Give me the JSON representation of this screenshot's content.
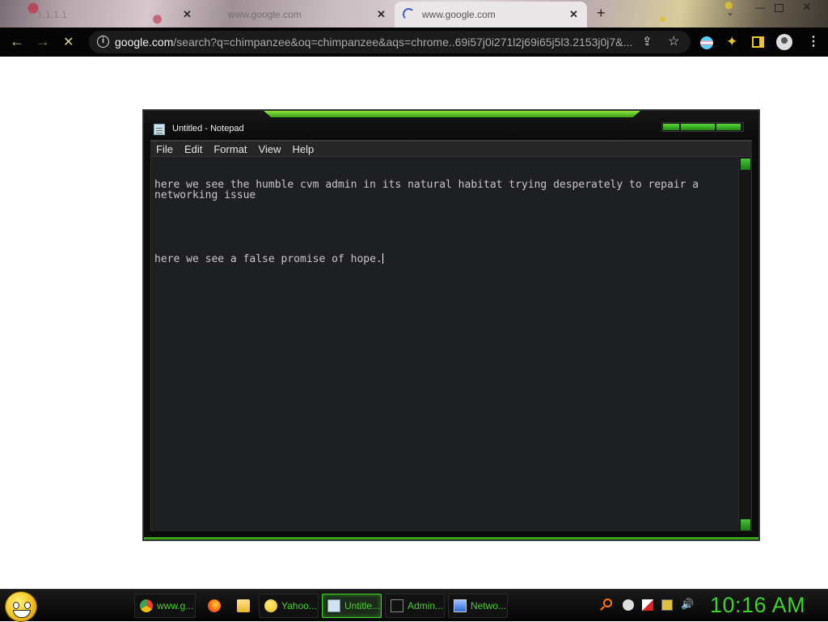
{
  "browser": {
    "tabs": [
      {
        "label": "1.1.1.1",
        "active": false
      },
      {
        "label": "www.google.com",
        "active": false
      },
      {
        "label": "www.google.com",
        "active": true
      }
    ],
    "new_tab_icon": "plus-icon",
    "url_host": "google.com",
    "url_rest": "/search?q=chimpanzee&oq=chimpanzee&aqs=chrome..69i57j0i271l2j69i65j5l3.2153j0j7&..."
  },
  "notepad": {
    "title": "Untitled - Notepad",
    "menu": [
      "File",
      "Edit",
      "Format",
      "View",
      "Help"
    ],
    "text_line1": "here we see the humble cvm admin in its natural habitat trying desperately to repair a networking issue",
    "text_line2": "here we see a false promise of hope."
  },
  "taskbar": {
    "tasks": [
      {
        "label": "www.g...",
        "icon": "chrome-icon"
      },
      {
        "label": "",
        "icon": "firefox-icon"
      },
      {
        "label": "",
        "icon": "folder-icon"
      },
      {
        "label": "Yahoo...",
        "icon": "yahoo-messenger-icon"
      },
      {
        "label": "Untitle...",
        "icon": "notepad-icon",
        "active": true
      },
      {
        "label": "Admin...",
        "icon": "cmd-icon"
      },
      {
        "label": "Netwo...",
        "icon": "network-icon"
      }
    ],
    "clock": "10:16 AM"
  },
  "colors": {
    "accent_green": "#46d42f",
    "browser_toolbar": "#050505",
    "notepad_background": "#1e1f22"
  }
}
